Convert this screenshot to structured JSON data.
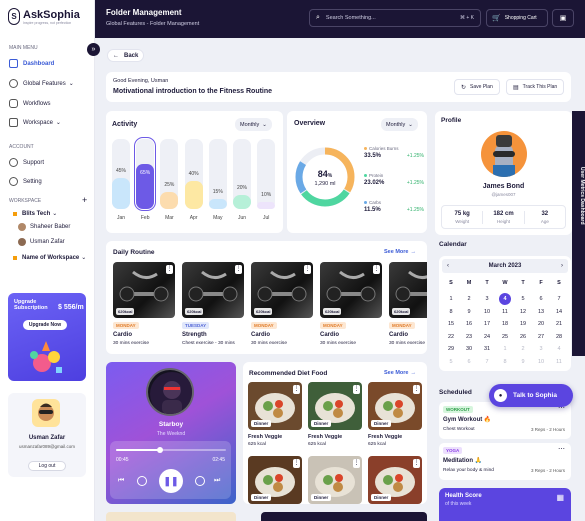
{
  "brand": {
    "name": "AskSophia",
    "tagline": "Inspire progress, not perfection"
  },
  "header": {
    "title": "Folder Management",
    "breadcrumb": "Global Features - Folder Management",
    "search_placeholder": "Search Something...",
    "shortcut": "⌘ + K",
    "shopping_cart": "Shopping Cart"
  },
  "sidebar": {
    "main_menu": "MAIN MENU",
    "items": [
      {
        "label": "Dashboard",
        "active": true
      },
      {
        "label": "Global Features"
      },
      {
        "label": "Workflows"
      },
      {
        "label": "Workspace"
      }
    ],
    "account": "ACCOUNT",
    "account_items": [
      {
        "label": "Support"
      },
      {
        "label": "Setting"
      }
    ],
    "workspace": "WORKSPACE",
    "workspaces": [
      {
        "label": "Blits Tech",
        "color": "#f59e0b"
      },
      {
        "label": "Shaheer Baber"
      },
      {
        "label": "Usman Zafar"
      },
      {
        "label": "Name of Workspace",
        "color": "#f59e0b"
      }
    ],
    "upgrade": {
      "title": "Upgrade Subscription",
      "price": "$ 556/m",
      "button": "Upgrade Now"
    },
    "user": {
      "name": "Usman Zafar",
      "email": "usmanzafar089@gmail.com",
      "logout": "Log out"
    }
  },
  "top": {
    "greeting": "Good Evening, Usman",
    "headline": "Motivational introduction to the Fitness Routine",
    "save_plan": "Save Plan",
    "track_plan": "Track This Plan",
    "back": "Back"
  },
  "activity": {
    "title": "Activity",
    "period": "Monthly"
  },
  "chart_data": {
    "type": "bar",
    "categories": [
      "Jan",
      "Feb",
      "Mar",
      "Apr",
      "May",
      "Jun",
      "Jul"
    ],
    "values": [
      45,
      65,
      25,
      40,
      15,
      20,
      10
    ],
    "ylim": [
      0,
      100
    ],
    "colors": [
      "#c9e6fb",
      "#6d5ae6",
      "#fcdcae",
      "#fde8a3",
      "#c9e6fb",
      "#b6f0d8",
      "#ede4fb"
    ]
  },
  "overview": {
    "title": "Overview",
    "period": "Monthly",
    "percent": "84",
    "percent_unit": "%",
    "volume": "1,290 ml",
    "stats": [
      {
        "label": "Calories Burns",
        "value": "33.5%",
        "change": "+1.25%",
        "color": "#f6b45c"
      },
      {
        "label": "Protein",
        "value": "23.02%",
        "change": "+1.25%",
        "color": "#4fd6a0"
      },
      {
        "label": "Carbs",
        "value": "11.5%",
        "change": "+1.25%",
        "color": "#6aa9e6"
      }
    ]
  },
  "profile": {
    "title": "Profile",
    "name": "James Bond",
    "handle": "@james007",
    "stats": [
      {
        "value": "75 kg",
        "label": "Weight"
      },
      {
        "value": "182 cm",
        "label": "Height"
      },
      {
        "value": "32",
        "label": "Age"
      }
    ]
  },
  "routine": {
    "title": "Daily Routine",
    "see_more": "See More",
    "items": [
      {
        "day": "MONDAY",
        "name": "Cardio",
        "detail": "30 mins exercise",
        "kcal": "620kcal",
        "tagcolor": "#fde7d2",
        "textcolor": "#e07b28"
      },
      {
        "day": "TUESDAY",
        "name": "Strength",
        "detail": "Chest exercise - 30 mins",
        "kcal": "620kcal",
        "tagcolor": "#e0e7fb",
        "textcolor": "#5467d6"
      },
      {
        "day": "MONDAY",
        "name": "Cardio",
        "detail": "30 mins exercise",
        "kcal": "620kcal",
        "tagcolor": "#fde7d2",
        "textcolor": "#e07b28"
      },
      {
        "day": "MONDAY",
        "name": "Cardio",
        "detail": "30 mins exercise",
        "kcal": "620kcal",
        "tagcolor": "#fde7d2",
        "textcolor": "#e07b28"
      },
      {
        "day": "MONDAY",
        "name": "Cardio",
        "detail": "30 mins exercise",
        "kcal": "620kcal",
        "tagcolor": "#fde7d2",
        "textcolor": "#e07b28"
      }
    ]
  },
  "calendar": {
    "title": "Calendar",
    "month": "March 2023",
    "weekdays": [
      "S",
      "M",
      "T",
      "W",
      "T",
      "F",
      "S"
    ],
    "days": [
      "1",
      "2",
      "3",
      "4",
      "5",
      "6",
      "7",
      "8",
      "9",
      "10",
      "11",
      "12",
      "13",
      "14",
      "15",
      "16",
      "17",
      "18",
      "19",
      "20",
      "21",
      "22",
      "23",
      "24",
      "25",
      "26",
      "27",
      "28",
      "29",
      "30",
      "31",
      "1",
      "2",
      "3",
      "4",
      "5",
      "6",
      "7",
      "8",
      "9",
      "10",
      "11"
    ],
    "selected": "4"
  },
  "player": {
    "song": "Starboy",
    "artist": "The Weeknd",
    "elapsed": "00:45",
    "total": "02:45",
    "progress": 0.4
  },
  "diet": {
    "title": "Recommended Diet Food",
    "see_more": "See More",
    "items": [
      {
        "tag": "Dinner",
        "name": "Fresh Veggie",
        "kcal": "625 kcal"
      },
      {
        "tag": "Dinner",
        "name": "Fresh Veggie",
        "kcal": "625 kcal"
      },
      {
        "tag": "Dinner",
        "name": "Fresh Veggie",
        "kcal": "625 kcal"
      },
      {
        "tag": "Dinner",
        "name": "",
        "kcal": ""
      },
      {
        "tag": "Dinner",
        "name": "",
        "kcal": ""
      },
      {
        "tag": "Dinner",
        "name": "",
        "kcal": ""
      }
    ]
  },
  "scheduled": {
    "title": "Scheduled",
    "items": [
      {
        "tag": "WORKOUT",
        "title": "Gym Workout 🔥",
        "subtitle": "Chest Workout",
        "meta": "3 Reps - 2 Hours",
        "tagcolor": "#d6f5dd",
        "textcolor": "#2f9d4a"
      },
      {
        "tag": "YOGA",
        "title": "Meditation 🙏",
        "subtitle": "Relax your body & mind",
        "meta": "3 Reps - 2 Hours",
        "tagcolor": "#ecdffd",
        "textcolor": "#8b3ee6"
      }
    ]
  },
  "health": {
    "title": "Health Score",
    "subtitle": "of this week"
  },
  "talk": {
    "label": "Talk to Sophia"
  },
  "side_tab": {
    "label": "User Metrics Dashboard"
  }
}
